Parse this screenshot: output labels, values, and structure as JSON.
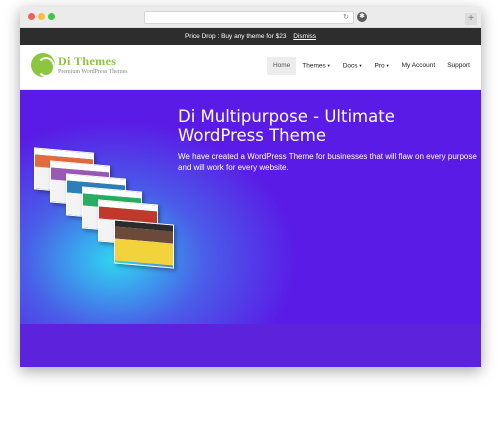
{
  "promo": {
    "text": "Price Drop : Buy any theme for $23",
    "dismiss": "Dismiss"
  },
  "logo": {
    "title": "Di Themes",
    "subtitle": "Premium WordPress Themes"
  },
  "nav": {
    "items": [
      {
        "label": "Home",
        "caret": ""
      },
      {
        "label": "Themes",
        "caret": "▼"
      },
      {
        "label": "Docs",
        "caret": "▼"
      },
      {
        "label": "Pro",
        "caret": "▼"
      },
      {
        "label": "My Account",
        "caret": ""
      },
      {
        "label": "Support",
        "caret": ""
      }
    ]
  },
  "hero": {
    "title": "Di Multipurpose - Ultimate WordPress Theme",
    "description": "We have created a WordPress Theme for businesses that will flaw on every purpose and will work for every website."
  },
  "icons": {
    "reload": "reload-icon",
    "extension": "extension-icon",
    "new_tab": "new-tab-icon"
  },
  "colors": {
    "brand": "#8cc63f",
    "hero_top": "#5a1be6",
    "hero_glow": "#2fd6f2",
    "promo_bar": "#2d2d2d"
  }
}
